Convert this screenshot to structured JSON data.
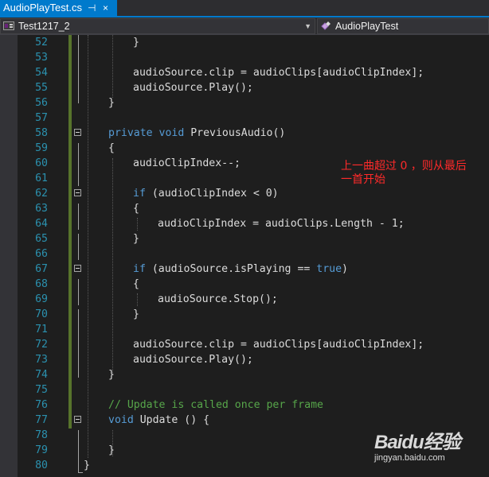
{
  "tab": {
    "title": "AudioPlayTest.cs",
    "pin_glyph": "⊣",
    "close_glyph": "×",
    "active_color": "#007acc"
  },
  "navbar": {
    "project": "Test1217_2",
    "member": "AudioPlayTest"
  },
  "editor": {
    "lines": [
      {
        "n": "52",
        "indent": 8,
        "parts": [
          [
            "",
            "}"
          ]
        ]
      },
      {
        "n": "53",
        "indent": 0,
        "parts": []
      },
      {
        "n": "54",
        "indent": 8,
        "parts": [
          [
            "",
            "audioSource.clip = audioClips[audioClipIndex];"
          ]
        ]
      },
      {
        "n": "55",
        "indent": 8,
        "parts": [
          [
            "",
            "audioSource.Play();"
          ]
        ]
      },
      {
        "n": "56",
        "indent": 4,
        "parts": [
          [
            "",
            "}"
          ]
        ]
      },
      {
        "n": "57",
        "indent": 0,
        "parts": []
      },
      {
        "n": "58",
        "indent": 4,
        "fold": true,
        "parts": [
          [
            "kw",
            "private"
          ],
          [
            "",
            " "
          ],
          [
            "kw",
            "void"
          ],
          [
            "",
            " PreviousAudio()"
          ]
        ]
      },
      {
        "n": "59",
        "indent": 4,
        "parts": [
          [
            "",
            "{"
          ]
        ]
      },
      {
        "n": "60",
        "indent": 8,
        "parts": [
          [
            "",
            "audioClipIndex--;"
          ]
        ]
      },
      {
        "n": "61",
        "indent": 0,
        "parts": []
      },
      {
        "n": "62",
        "indent": 8,
        "fold": true,
        "parts": [
          [
            "kw",
            "if"
          ],
          [
            "",
            " (audioClipIndex < 0)"
          ]
        ]
      },
      {
        "n": "63",
        "indent": 8,
        "parts": [
          [
            "",
            "{"
          ]
        ]
      },
      {
        "n": "64",
        "indent": 12,
        "parts": [
          [
            "",
            "audioClipIndex = audioClips.Length - 1;"
          ]
        ]
      },
      {
        "n": "65",
        "indent": 8,
        "parts": [
          [
            "",
            "}"
          ]
        ]
      },
      {
        "n": "66",
        "indent": 0,
        "parts": []
      },
      {
        "n": "67",
        "indent": 8,
        "fold": true,
        "parts": [
          [
            "kw",
            "if"
          ],
          [
            "",
            " (audioSource.isPlaying == "
          ],
          [
            "kw",
            "true"
          ],
          [
            "",
            ")"
          ]
        ]
      },
      {
        "n": "68",
        "indent": 8,
        "parts": [
          [
            "",
            "{"
          ]
        ]
      },
      {
        "n": "69",
        "indent": 12,
        "parts": [
          [
            "",
            "audioSource.Stop();"
          ]
        ]
      },
      {
        "n": "70",
        "indent": 8,
        "parts": [
          [
            "",
            "}"
          ]
        ]
      },
      {
        "n": "71",
        "indent": 0,
        "parts": []
      },
      {
        "n": "72",
        "indent": 8,
        "parts": [
          [
            "",
            "audioSource.clip = audioClips[audioClipIndex];"
          ]
        ]
      },
      {
        "n": "73",
        "indent": 8,
        "parts": [
          [
            "",
            "audioSource.Play();"
          ]
        ]
      },
      {
        "n": "74",
        "indent": 4,
        "parts": [
          [
            "",
            "}"
          ]
        ]
      },
      {
        "n": "75",
        "indent": 0,
        "parts": []
      },
      {
        "n": "76",
        "indent": 4,
        "parts": [
          [
            "cm",
            "// Update is called once per frame"
          ]
        ]
      },
      {
        "n": "77",
        "indent": 4,
        "fold": true,
        "parts": [
          [
            "kw",
            "void"
          ],
          [
            "",
            " Update () {"
          ]
        ]
      },
      {
        "n": "78",
        "indent": 0,
        "parts": []
      },
      {
        "n": "79",
        "indent": 4,
        "parts": [
          [
            "",
            "}"
          ]
        ]
      },
      {
        "n": "80",
        "indent": 0,
        "parts": [
          [
            "",
            "}"
          ]
        ]
      }
    ],
    "colors": {
      "keyword": "#569cd6",
      "comment": "#57a64a",
      "line_number": "#2b91af",
      "text": "#dcdcdc",
      "change_bar": "#57732b"
    }
  },
  "annotation": {
    "lines": [
      "上一曲超过 0 ，则从最后",
      "一首开始"
    ],
    "color": "#ff2a2a"
  },
  "watermark": {
    "logo": "Baidu经验",
    "url": "jingyan.baidu.com"
  }
}
